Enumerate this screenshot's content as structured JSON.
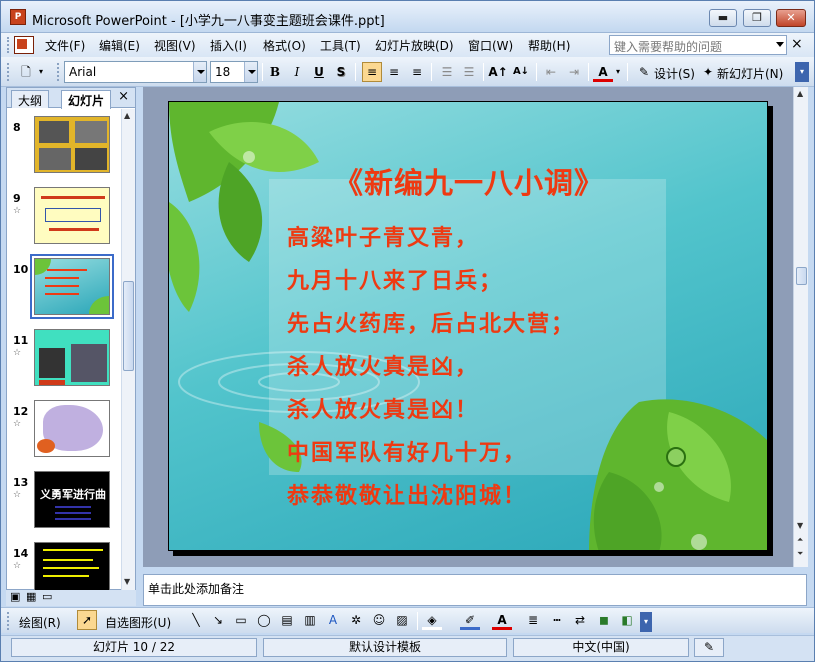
{
  "window": {
    "title": "Microsoft PowerPoint - [小学九一八事变主题班会课件.ppt]"
  },
  "menu": {
    "items": [
      "文件(F)",
      "编辑(E)",
      "视图(V)",
      "插入(I)",
      "格式(O)",
      "工具(T)",
      "幻灯片放映(D)",
      "窗口(W)",
      "帮助(H)"
    ],
    "help_placeholder": "键入需要帮助的问题"
  },
  "toolbar": {
    "font": "Arial",
    "size": "18",
    "bold": "B",
    "italic": "I",
    "underline": "U",
    "shadow": "S",
    "design": "设计(S)",
    "new_slide": "新幻灯片(N)"
  },
  "panel": {
    "tab_outline": "大纲",
    "tab_slides": "幻灯片",
    "close": "×",
    "slides": [
      {
        "num": "8"
      },
      {
        "num": "9"
      },
      {
        "num": "10"
      },
      {
        "num": "11"
      },
      {
        "num": "12"
      },
      {
        "num": "13",
        "text": "义勇军进行曲"
      },
      {
        "num": "14"
      }
    ]
  },
  "slide": {
    "title": "《新编九一八小调》",
    "lines": [
      "高粱叶子青又青，",
      "九月十八来了日兵；",
      "先占火药库，后占北大营；",
      "杀人放火真是凶，",
      "杀人放火真是凶！",
      "中国军队有好几十万，",
      "恭恭敬敬让出沈阳城！"
    ]
  },
  "notes": {
    "placeholder": "单击此处添加备注"
  },
  "drawbar": {
    "draw": "绘图(R)",
    "autoshapes": "自选图形(U)"
  },
  "status": {
    "slide": "幻灯片 10 / 22",
    "template": "默认设计模板",
    "language": "中文(中国)"
  },
  "colors": {
    "title_red": "#ee3a12",
    "slide_teal": "#52c4cc",
    "leaf_green": "#6cc43a"
  }
}
